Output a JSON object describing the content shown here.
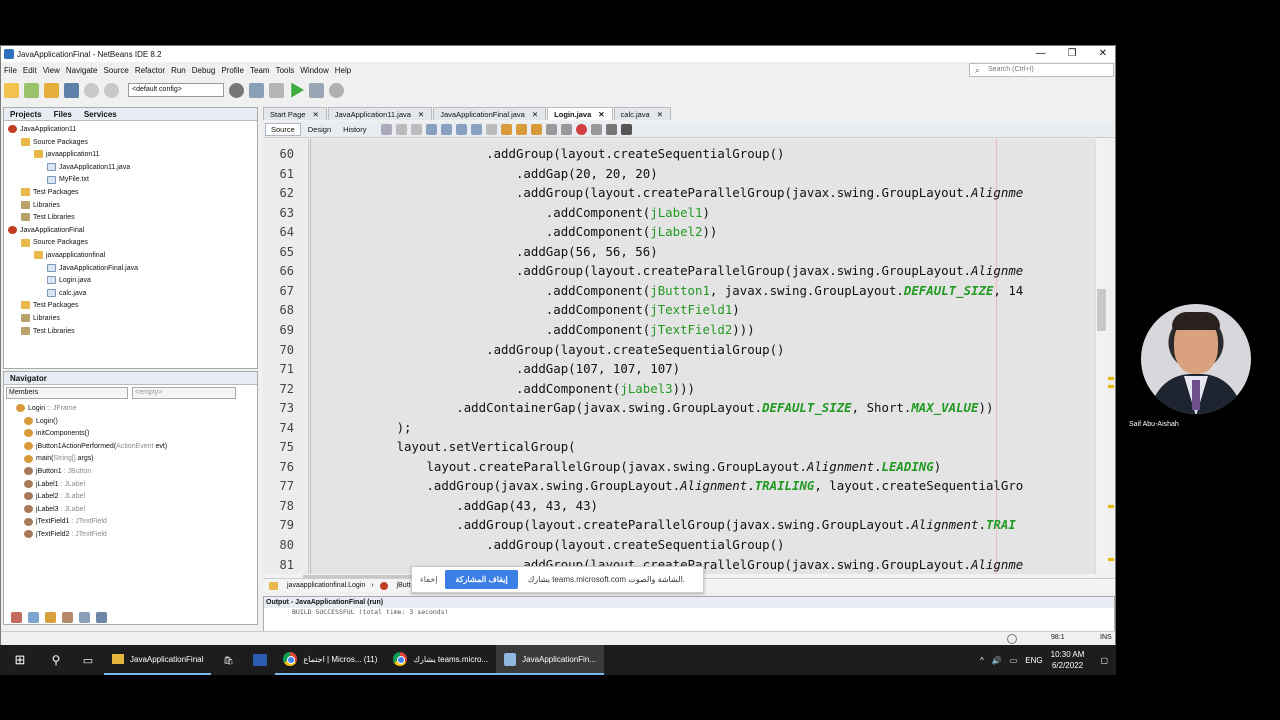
{
  "window": {
    "title": "JavaApplicationFinal - NetBeans IDE 8.2",
    "controls": [
      "—",
      "❐",
      "✕"
    ]
  },
  "menu": [
    "File",
    "Edit",
    "View",
    "Navigate",
    "Source",
    "Refactor",
    "Run",
    "Debug",
    "Profile",
    "Team",
    "Tools",
    "Window",
    "Help"
  ],
  "search": {
    "placeholder": "Search (Ctrl+I)"
  },
  "toolbar": {
    "config": "<default config>"
  },
  "projects": {
    "tabs": [
      "Projects",
      "Files",
      "Services"
    ],
    "tree": [
      {
        "label": "JavaApplication11",
        "icon": "cup",
        "indent": 0
      },
      {
        "label": "Source Packages",
        "icon": "fold",
        "indent": 1
      },
      {
        "label": "javaapplication11",
        "icon": "fold",
        "indent": 2
      },
      {
        "label": "JavaApplication11.java",
        "icon": "jfile",
        "indent": 3
      },
      {
        "label": "MyFile.txt",
        "icon": "jfile",
        "indent": 3
      },
      {
        "label": "Test Packages",
        "icon": "fold",
        "indent": 1
      },
      {
        "label": "Libraries",
        "icon": "lib",
        "indent": 1
      },
      {
        "label": "Test Libraries",
        "icon": "lib",
        "indent": 1
      },
      {
        "label": "JavaApplicationFinal",
        "icon": "cup",
        "indent": 0
      },
      {
        "label": "Source Packages",
        "icon": "fold",
        "indent": 1
      },
      {
        "label": "javaapplicationfinal",
        "icon": "fold",
        "indent": 2
      },
      {
        "label": "JavaApplicationFinal.java",
        "icon": "jfile",
        "indent": 3
      },
      {
        "label": "Login.java",
        "icon": "jfile",
        "indent": 3
      },
      {
        "label": "calc.java",
        "icon": "jfile",
        "indent": 3
      },
      {
        "label": "Test Packages",
        "icon": "fold",
        "indent": 1
      },
      {
        "label": "Libraries",
        "icon": "lib",
        "indent": 1
      },
      {
        "label": "Test Libraries",
        "icon": "lib",
        "indent": 1
      }
    ]
  },
  "navigator": {
    "title": "Navigator",
    "filter": "Members",
    "empty": "<empty>",
    "items": [
      {
        "name": "Login",
        "type": " :: JFrame",
        "indent": 0
      },
      {
        "name": "Login()",
        "type": "",
        "indent": 1
      },
      {
        "name": "initComponents()",
        "type": "",
        "indent": 1
      },
      {
        "name": "jButton1ActionPerformed(",
        "type": "ActionEvent",
        "rest": " evt)",
        "indent": 1
      },
      {
        "name": "main(",
        "type": "String[]",
        "rest": " args)",
        "indent": 1
      },
      {
        "name": "jButton1",
        "type": " : JButton",
        "indent": 1
      },
      {
        "name": "jLabel1",
        "type": " : JLabel",
        "indent": 1
      },
      {
        "name": "jLabel2",
        "type": " : JLabel",
        "indent": 1
      },
      {
        "name": "jLabel3",
        "type": " : JLabel",
        "indent": 1
      },
      {
        "name": "jTextField1",
        "type": " : JTextField",
        "indent": 1
      },
      {
        "name": "jTextField2",
        "type": " : JTextField",
        "indent": 1
      }
    ]
  },
  "editor": {
    "tabs": [
      {
        "label": "Start Page",
        "active": false
      },
      {
        "label": "JavaApplication11.java",
        "active": false
      },
      {
        "label": "JavaApplicationFinal.java",
        "active": false
      },
      {
        "label": "Login.java",
        "active": true
      },
      {
        "label": "calc.java",
        "active": false
      }
    ],
    "modes": [
      "Source",
      "Design",
      "History"
    ],
    "lines": [
      {
        "n": "60",
        "indent": 22,
        "parts": [
          [
            ".addGroup(layout.createSequentialGroup()",
            "p"
          ]
        ]
      },
      {
        "n": "61",
        "indent": 26,
        "parts": [
          [
            ".addGap(20, 20, 20)",
            "p"
          ]
        ]
      },
      {
        "n": "62",
        "indent": 26,
        "parts": [
          [
            ".addGroup(layout.createParallelGroup(javax.swing.GroupLayout.",
            "p"
          ],
          [
            "Alignme",
            "i"
          ]
        ]
      },
      {
        "n": "63",
        "indent": 30,
        "parts": [
          [
            ".addComponent(",
            "p"
          ],
          [
            "jLabel1",
            "g"
          ],
          [
            ")",
            "p"
          ]
        ]
      },
      {
        "n": "64",
        "indent": 30,
        "parts": [
          [
            ".addComponent(",
            "p"
          ],
          [
            "jLabel2",
            "g"
          ],
          [
            "))",
            "p"
          ]
        ]
      },
      {
        "n": "65",
        "indent": 26,
        "parts": [
          [
            ".addGap(56, 56, 56)",
            "p"
          ]
        ]
      },
      {
        "n": "66",
        "indent": 26,
        "parts": [
          [
            ".addGroup(layout.createParallelGroup(javax.swing.GroupLayout.",
            "p"
          ],
          [
            "Alignme",
            "i"
          ]
        ]
      },
      {
        "n": "67",
        "indent": 30,
        "parts": [
          [
            ".addComponent(",
            "p"
          ],
          [
            "jButton1",
            "g"
          ],
          [
            ", javax.swing.GroupLayout.",
            "p"
          ],
          [
            "DEFAULT_SIZE",
            "gi"
          ],
          [
            ", 14",
            "p"
          ]
        ]
      },
      {
        "n": "68",
        "indent": 30,
        "parts": [
          [
            ".addComponent(",
            "p"
          ],
          [
            "jTextField1",
            "g"
          ],
          [
            ")",
            "p"
          ]
        ]
      },
      {
        "n": "69",
        "indent": 30,
        "parts": [
          [
            ".addComponent(",
            "p"
          ],
          [
            "jTextField2",
            "g"
          ],
          [
            ")))",
            "p"
          ]
        ]
      },
      {
        "n": "70",
        "indent": 22,
        "parts": [
          [
            ".addGroup(layout.createSequentialGroup()",
            "p"
          ]
        ]
      },
      {
        "n": "71",
        "indent": 26,
        "parts": [
          [
            ".addGap(107, 107, 107)",
            "p"
          ]
        ]
      },
      {
        "n": "72",
        "indent": 26,
        "parts": [
          [
            ".addComponent(",
            "p"
          ],
          [
            "jLabel3",
            "g"
          ],
          [
            ")))",
            "p"
          ]
        ]
      },
      {
        "n": "73",
        "indent": 18,
        "parts": [
          [
            ".addContainerGap(javax.swing.GroupLayout.",
            "p"
          ],
          [
            "DEFAULT_SIZE",
            "gi"
          ],
          [
            ", Short.",
            "p"
          ],
          [
            "MAX_VALUE",
            "gi"
          ],
          [
            "))",
            "p"
          ]
        ]
      },
      {
        "n": "74",
        "indent": 10,
        "parts": [
          [
            ");",
            "p"
          ]
        ]
      },
      {
        "n": "75",
        "indent": 10,
        "parts": [
          [
            "layout.setVerticalGroup(",
            "p"
          ]
        ]
      },
      {
        "n": "76",
        "indent": 14,
        "parts": [
          [
            "layout.createParallelGroup(javax.swing.GroupLayout.",
            "p"
          ],
          [
            "Alignment",
            "i"
          ],
          [
            ".",
            "p"
          ],
          [
            "LEADING",
            "gi"
          ],
          [
            ")",
            "p"
          ]
        ]
      },
      {
        "n": "77",
        "indent": 14,
        "parts": [
          [
            ".addGroup(javax.swing.GroupLayout.",
            "p"
          ],
          [
            "Alignment",
            "i"
          ],
          [
            ".",
            "p"
          ],
          [
            "TRAILING",
            "gi"
          ],
          [
            ", layout.createSequentialGro",
            "p"
          ]
        ]
      },
      {
        "n": "78",
        "indent": 18,
        "parts": [
          [
            ".addGap(43, 43, 43)",
            "p"
          ]
        ]
      },
      {
        "n": "79",
        "indent": 18,
        "parts": [
          [
            ".addGroup(layout.createParallelGroup(javax.swing.GroupLayout.",
            "p"
          ],
          [
            "Alignment",
            "i"
          ],
          [
            ".",
            "p"
          ],
          [
            "TRAI",
            "gi"
          ]
        ]
      },
      {
        "n": "80",
        "indent": 22,
        "parts": [
          [
            ".addGroup(layout.createSequentialGroup()",
            "p"
          ]
        ]
      },
      {
        "n": "81",
        "indent": 26,
        "parts": [
          [
            ".addGroup(layout.createParallelGroup(javax.swing.GroupLayout.",
            "p"
          ],
          [
            "Alignme",
            "i"
          ]
        ]
      }
    ]
  },
  "breadcrumb": [
    "javaapplicationfinal.Login",
    "jButton1ActionPerformed"
  ],
  "output": {
    "title": "Output - JavaApplicationFinal (run)",
    "text": "BUILD SUCCESSFUL (total time: 3 seconds)"
  },
  "status": {
    "position": "98:1",
    "mode": "INS"
  },
  "teams": {
    "hide": "إخفاء",
    "stop": "إيقاف المشاركة",
    "message": "يشارك teams.microsoft.com الشاشة والصوت."
  },
  "taskbar": {
    "items": [
      "JavaApplicationFinal",
      "اجتماع | Micros... (11)",
      "يشارك teams.micro...",
      "JavaApplicationFin..."
    ],
    "language": "ENG",
    "time": "10:30 AM",
    "date": "6/2/2022"
  },
  "presenter": {
    "name": "Saif Abu-Aishah"
  },
  "colors": {
    "accent": "#3a7ee6",
    "code_green": "#229a22",
    "tab_active": "#ffffff"
  }
}
